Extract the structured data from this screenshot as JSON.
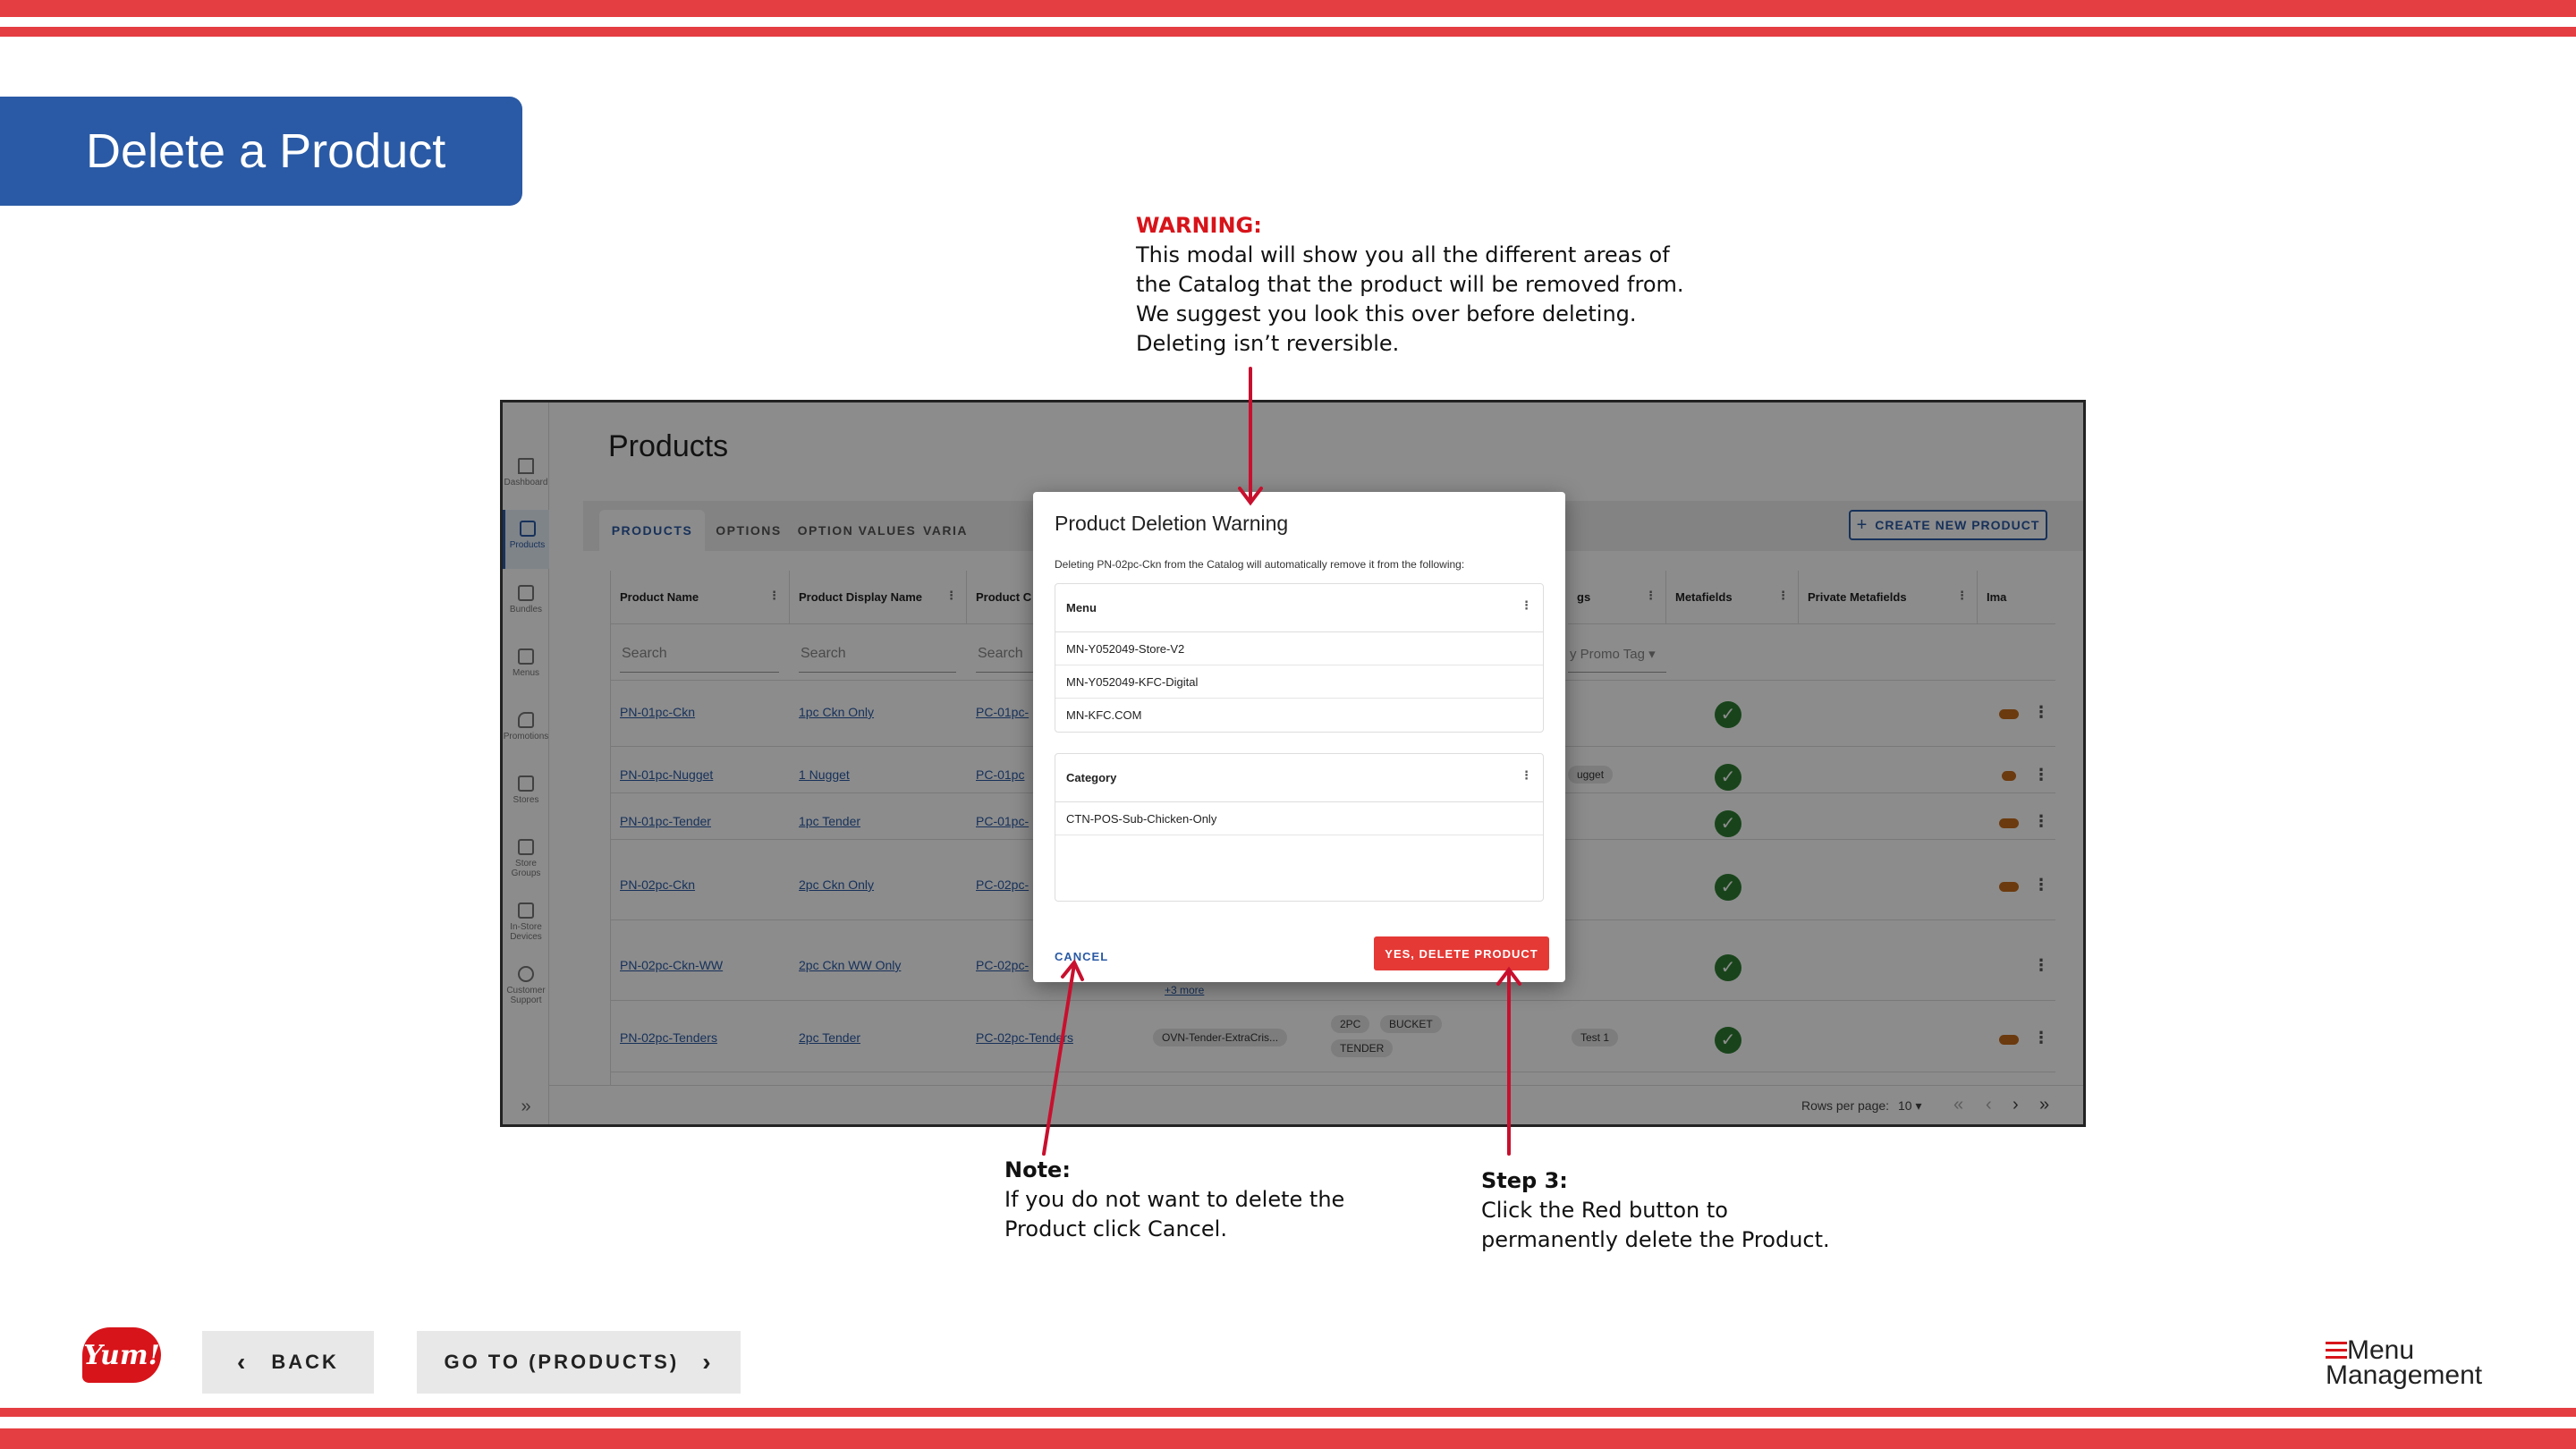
{
  "slide": {
    "title": "Delete a Product",
    "warning": {
      "heading": "WARNING:",
      "lines": [
        "This modal will show you all the different areas of",
        "the Catalog that the product will be removed from.",
        "We suggest you look this over before deleting.",
        "Deleting isn’t reversible."
      ]
    },
    "note": {
      "heading": "Note:",
      "lines": [
        "If you do not want to delete the",
        "Product click Cancel."
      ]
    },
    "step3": {
      "heading": "Step 3:",
      "lines": [
        "Click the Red button to",
        "permanently delete the Product."
      ]
    },
    "nav": {
      "back": "BACK",
      "goto": "GO TO (PRODUCTS)"
    },
    "logos": {
      "yum": "Yum!",
      "mm_line1": "Menu",
      "mm_line2": "Management"
    },
    "colors": {
      "stripe": "#e53e42",
      "title_bg": "#2a5aa5",
      "warning": "#d7141a",
      "delete_button": "#e53935"
    }
  },
  "app": {
    "page_title": "Products",
    "sidebar": [
      {
        "label": "Dashboard",
        "icon": "home-icon"
      },
      {
        "label": "Products",
        "icon": "box-icon",
        "active": true
      },
      {
        "label": "Bundles",
        "icon": "cube-icon"
      },
      {
        "label": "Menus",
        "icon": "document-icon"
      },
      {
        "label": "Promotions",
        "icon": "tag-icon"
      },
      {
        "label": "Stores",
        "icon": "store-icon"
      },
      {
        "label": "Store Groups",
        "icon": "grid-icon"
      },
      {
        "label": "In-Store Devices",
        "icon": "monitor-icon"
      },
      {
        "label": "Customer Support",
        "icon": "support-icon"
      }
    ],
    "tabs": [
      "PRODUCTS",
      "OPTIONS",
      "OPTION VALUES",
      "VARIA"
    ],
    "create_button": "CREATE NEW PRODUCT",
    "columns": [
      "Product Name",
      "Product Display Name",
      "Product C",
      "gs",
      "Metafields",
      "Private Metafields",
      "Ima"
    ],
    "search_placeholder": "Search",
    "promo_filter": "y Promo Tag",
    "rows": [
      {
        "name": "PN-01pc-Ckn",
        "display": "1pc Ckn Only",
        "code": "PC-01pc-"
      },
      {
        "name": "PN-01pc-Nugget",
        "display": "1 Nugget",
        "code": "PC-01pc",
        "tag": "ugget"
      },
      {
        "name": "PN-01pc-Tender",
        "display": "1pc Tender",
        "code": "PC-01pc-"
      },
      {
        "name": "PN-02pc-Ckn",
        "display": "2pc Ckn Only",
        "code": "PC-02pc-"
      },
      {
        "name": "PN-02pc-Ckn-WW",
        "display": "2pc Ckn WW Only",
        "code": "PC-02pc-",
        "more": "+3 more"
      },
      {
        "name": "PN-02pc-Tenders",
        "display": "2pc Tender",
        "code": "PC-02pc-Tenders",
        "option": "OVN-Tender-ExtraCris...",
        "chips": [
          "2PC",
          "BUCKET",
          "TENDER"
        ],
        "tag": "Test 1"
      }
    ],
    "footer": {
      "rows_per_page_label": "Rows per page:",
      "rows_per_page_value": "10"
    }
  },
  "modal": {
    "title": "Product Deletion Warning",
    "description": "Deleting PN-02pc-Ckn from the Catalog will automatically remove it from the following:",
    "sections": [
      {
        "heading": "Menu",
        "items": [
          "MN-Y052049-Store-V2",
          "MN-Y052049-KFC-Digital",
          "MN-KFC.COM"
        ]
      },
      {
        "heading": "Category",
        "items": [
          "CTN-POS-Sub-Chicken-Only"
        ]
      }
    ],
    "cancel": "CANCEL",
    "confirm": "YES, DELETE PRODUCT"
  }
}
